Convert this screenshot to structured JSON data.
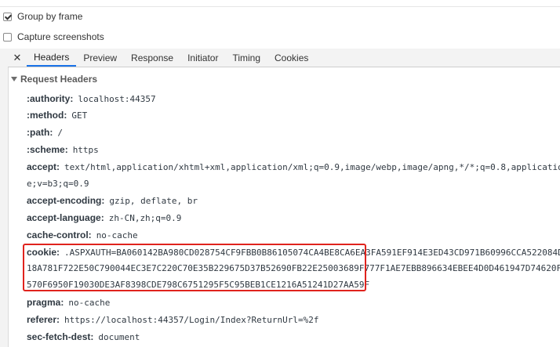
{
  "options": {
    "group_by_frame": {
      "label": "Group by frame",
      "checked": true
    },
    "capture_screenshots": {
      "label": "Capture screenshots",
      "checked": false
    }
  },
  "tabs": {
    "close": "✕",
    "items": [
      "Headers",
      "Preview",
      "Response",
      "Initiator",
      "Timing",
      "Cookies"
    ],
    "active": "Headers"
  },
  "section": {
    "title": "Request Headers"
  },
  "headers": [
    {
      "name": ":authority:",
      "value": "localhost:44357"
    },
    {
      "name": ":method:",
      "value": "GET"
    },
    {
      "name": ":path:",
      "value": "/"
    },
    {
      "name": ":scheme:",
      "value": "https"
    },
    {
      "name": "accept:",
      "value": "text/html,application/xhtml+xml,application/xml;q=0.9,image/webp,image/apng,*/*;q=0.8,applicatio",
      "cont": "e;v=b3;q=0.9"
    },
    {
      "name": "accept-encoding:",
      "value": "gzip, deflate, br"
    },
    {
      "name": "accept-language:",
      "value": "zh-CN,zh;q=0.9"
    },
    {
      "name": "cache-control:",
      "value": "no-cache"
    },
    {
      "name": "cookie:",
      "value": ".ASPXAUTH=BA060142BA980CD028754CF9FBB0B86105074CA4BE8CA6EA3FA591EF914E3ED43CD971B60996CCA522084D",
      "cont": "18A781F722E50C790044EC3E7C220C70E35B229675D37B52690FB22E25003689F777F1AE7EBB896634EBEE4D0D461947D74620F",
      "cont2": "570F6950F19030DE3AF8398CDE798C6751295F5C95BEB1CE1216A51241D27AA59F"
    },
    {
      "name": "pragma:",
      "value": "no-cache"
    },
    {
      "name": "referer:",
      "value": "https://localhost:44357/Login/Index?ReturnUrl=%2f"
    },
    {
      "name": "sec-fetch-dest:",
      "value": "document"
    }
  ]
}
